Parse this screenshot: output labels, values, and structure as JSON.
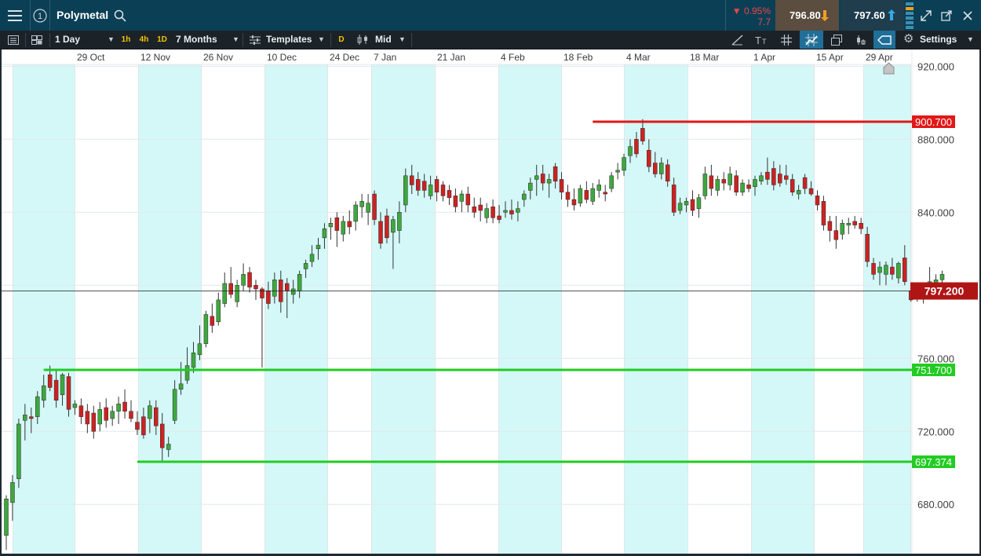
{
  "header": {
    "instrument": "Polymetal",
    "change_pct": "▼ 0.95%",
    "change_abs": "7.7",
    "sell_price": "796.80",
    "buy_price": "797.60"
  },
  "toolbar": {
    "interval": "1 Day",
    "quick_intervals": [
      "1h",
      "4h",
      "1D"
    ],
    "range": "7 Months",
    "templates_label": "Templates",
    "d_badge": "D",
    "price_type": "Mid",
    "settings_label": "Settings"
  },
  "colors": {
    "up": "#3ea83e",
    "down": "#cc2222",
    "resistance": "#e01818",
    "support": "#22cc22",
    "current_price": "#b01515",
    "band": "#d4f8f8"
  },
  "chart_data": {
    "type": "candlestick",
    "x_labels": [
      "29 Oct",
      "12 Nov",
      "26 Nov",
      "10 Dec",
      "24 Dec",
      "7 Jan",
      "21 Jan",
      "4 Feb",
      "18 Feb",
      "4 Mar",
      "18 Mar",
      "1 Apr",
      "15 Apr",
      "29 Apr"
    ],
    "y_ticks": [
      680,
      720,
      760,
      800,
      840,
      880,
      920
    ],
    "y_tick_labels": [
      "680.000",
      "720.000",
      "760.000",
      "800.000",
      "840.000",
      "880.000",
      "920.000"
    ],
    "ylim": [
      653,
      921
    ],
    "grid": true,
    "current_price": 797.2,
    "current_price_label": "797.200",
    "price_lines": [
      {
        "value": 889.7,
        "label": "900.700",
        "kind": "resistance"
      },
      {
        "value": 753.5,
        "label": "751.700",
        "kind": "support"
      },
      {
        "value": 703.2,
        "label": "697.374",
        "kind": "support"
      }
    ],
    "candles": [
      {
        "o": 663,
        "h": 685,
        "l": 655,
        "c": 683
      },
      {
        "o": 681,
        "h": 696,
        "l": 671,
        "c": 692
      },
      {
        "o": 694,
        "h": 727,
        "l": 689,
        "c": 724
      },
      {
        "o": 726,
        "h": 735,
        "l": 715,
        "c": 729
      },
      {
        "o": 728,
        "h": 733,
        "l": 719,
        "c": 727
      },
      {
        "o": 728,
        "h": 742,
        "l": 724,
        "c": 739
      },
      {
        "o": 737,
        "h": 751,
        "l": 733,
        "c": 745
      },
      {
        "o": 751,
        "h": 756,
        "l": 742,
        "c": 744
      },
      {
        "o": 748,
        "h": 754,
        "l": 733,
        "c": 737
      },
      {
        "o": 740,
        "h": 752,
        "l": 734,
        "c": 751
      },
      {
        "o": 750,
        "h": 752,
        "l": 728,
        "c": 732
      },
      {
        "o": 733,
        "h": 737,
        "l": 729,
        "c": 735
      },
      {
        "o": 734,
        "h": 738,
        "l": 724,
        "c": 728
      },
      {
        "o": 731,
        "h": 735,
        "l": 719,
        "c": 724
      },
      {
        "o": 730,
        "h": 734,
        "l": 716,
        "c": 720
      },
      {
        "o": 724,
        "h": 736,
        "l": 720,
        "c": 732
      },
      {
        "o": 733,
        "h": 738,
        "l": 722,
        "c": 726
      },
      {
        "o": 727,
        "h": 734,
        "l": 723,
        "c": 731
      },
      {
        "o": 731,
        "h": 739,
        "l": 724,
        "c": 735
      },
      {
        "o": 736,
        "h": 743,
        "l": 727,
        "c": 731
      },
      {
        "o": 731,
        "h": 737,
        "l": 725,
        "c": 727
      },
      {
        "o": 725,
        "h": 731,
        "l": 718,
        "c": 721
      },
      {
        "o": 728,
        "h": 733,
        "l": 716,
        "c": 718
      },
      {
        "o": 727,
        "h": 737,
        "l": 719,
        "c": 734
      },
      {
        "o": 733,
        "h": 737,
        "l": 718,
        "c": 723
      },
      {
        "o": 724,
        "h": 730,
        "l": 703,
        "c": 711
      },
      {
        "o": 710,
        "h": 717,
        "l": 706,
        "c": 713
      },
      {
        "o": 726,
        "h": 748,
        "l": 724,
        "c": 743
      },
      {
        "o": 743,
        "h": 758,
        "l": 740,
        "c": 746
      },
      {
        "o": 748,
        "h": 766,
        "l": 746,
        "c": 756
      },
      {
        "o": 755,
        "h": 769,
        "l": 752,
        "c": 763
      },
      {
        "o": 762,
        "h": 778,
        "l": 759,
        "c": 768
      },
      {
        "o": 768,
        "h": 786,
        "l": 766,
        "c": 784
      },
      {
        "o": 783,
        "h": 790,
        "l": 774,
        "c": 778
      },
      {
        "o": 780,
        "h": 796,
        "l": 778,
        "c": 792
      },
      {
        "o": 790,
        "h": 807,
        "l": 788,
        "c": 801
      },
      {
        "o": 801,
        "h": 810,
        "l": 793,
        "c": 795
      },
      {
        "o": 791,
        "h": 803,
        "l": 788,
        "c": 800
      },
      {
        "o": 800,
        "h": 812,
        "l": 797,
        "c": 806
      },
      {
        "o": 807,
        "h": 810,
        "l": 796,
        "c": 799
      },
      {
        "o": 800,
        "h": 803,
        "l": 792,
        "c": 798
      },
      {
        "o": 798,
        "h": 799,
        "l": 755,
        "c": 793
      },
      {
        "o": 797,
        "h": 802,
        "l": 787,
        "c": 790
      },
      {
        "o": 794,
        "h": 807,
        "l": 790,
        "c": 803
      },
      {
        "o": 803,
        "h": 808,
        "l": 785,
        "c": 791
      },
      {
        "o": 801,
        "h": 804,
        "l": 782,
        "c": 797
      },
      {
        "o": 795,
        "h": 803,
        "l": 790,
        "c": 798
      },
      {
        "o": 797,
        "h": 808,
        "l": 793,
        "c": 806
      },
      {
        "o": 809,
        "h": 814,
        "l": 804,
        "c": 812
      },
      {
        "o": 813,
        "h": 822,
        "l": 810,
        "c": 817
      },
      {
        "o": 820,
        "h": 826,
        "l": 814,
        "c": 822
      },
      {
        "o": 826,
        "h": 834,
        "l": 820,
        "c": 831
      },
      {
        "o": 832,
        "h": 837,
        "l": 825,
        "c": 834
      },
      {
        "o": 837,
        "h": 840,
        "l": 821,
        "c": 830
      },
      {
        "o": 828,
        "h": 838,
        "l": 824,
        "c": 835
      },
      {
        "o": 835,
        "h": 841,
        "l": 828,
        "c": 832
      },
      {
        "o": 835,
        "h": 846,
        "l": 830,
        "c": 844
      },
      {
        "o": 843,
        "h": 850,
        "l": 837,
        "c": 846
      },
      {
        "o": 840,
        "h": 850,
        "l": 833,
        "c": 845
      },
      {
        "o": 850,
        "h": 852,
        "l": 833,
        "c": 836
      },
      {
        "o": 835,
        "h": 840,
        "l": 820,
        "c": 823
      },
      {
        "o": 838,
        "h": 842,
        "l": 823,
        "c": 826
      },
      {
        "o": 829,
        "h": 838,
        "l": 809,
        "c": 836
      },
      {
        "o": 830,
        "h": 846,
        "l": 823,
        "c": 840
      },
      {
        "o": 844,
        "h": 864,
        "l": 840,
        "c": 860
      },
      {
        "o": 860,
        "h": 866,
        "l": 850,
        "c": 855
      },
      {
        "o": 858,
        "h": 862,
        "l": 849,
        "c": 852
      },
      {
        "o": 857,
        "h": 861,
        "l": 848,
        "c": 852
      },
      {
        "o": 849,
        "h": 860,
        "l": 847,
        "c": 855
      },
      {
        "o": 858,
        "h": 860,
        "l": 846,
        "c": 851
      },
      {
        "o": 855,
        "h": 857,
        "l": 846,
        "c": 849
      },
      {
        "o": 852,
        "h": 855,
        "l": 844,
        "c": 848
      },
      {
        "o": 849,
        "h": 853,
        "l": 840,
        "c": 843
      },
      {
        "o": 846,
        "h": 852,
        "l": 840,
        "c": 850
      },
      {
        "o": 850,
        "h": 854,
        "l": 840,
        "c": 844
      },
      {
        "o": 843,
        "h": 848,
        "l": 837,
        "c": 840
      },
      {
        "o": 844,
        "h": 848,
        "l": 835,
        "c": 841
      },
      {
        "o": 837,
        "h": 845,
        "l": 834,
        "c": 842
      },
      {
        "o": 843,
        "h": 847,
        "l": 834,
        "c": 837
      },
      {
        "o": 838,
        "h": 844,
        "l": 834,
        "c": 836
      },
      {
        "o": 840,
        "h": 846,
        "l": 837,
        "c": 841
      },
      {
        "o": 841,
        "h": 847,
        "l": 836,
        "c": 839
      },
      {
        "o": 840,
        "h": 846,
        "l": 835,
        "c": 842
      },
      {
        "o": 847,
        "h": 852,
        "l": 843,
        "c": 850
      },
      {
        "o": 852,
        "h": 859,
        "l": 847,
        "c": 856
      },
      {
        "o": 858,
        "h": 866,
        "l": 849,
        "c": 860
      },
      {
        "o": 861,
        "h": 866,
        "l": 852,
        "c": 856
      },
      {
        "o": 856,
        "h": 861,
        "l": 848,
        "c": 858
      },
      {
        "o": 865,
        "h": 867,
        "l": 853,
        "c": 857
      },
      {
        "o": 858,
        "h": 862,
        "l": 847,
        "c": 851
      },
      {
        "o": 851,
        "h": 855,
        "l": 843,
        "c": 847
      },
      {
        "o": 847,
        "h": 853,
        "l": 841,
        "c": 844
      },
      {
        "o": 845,
        "h": 855,
        "l": 843,
        "c": 853
      },
      {
        "o": 852,
        "h": 857,
        "l": 845,
        "c": 847
      },
      {
        "o": 846,
        "h": 856,
        "l": 844,
        "c": 853
      },
      {
        "o": 852,
        "h": 858,
        "l": 848,
        "c": 855
      },
      {
        "o": 851,
        "h": 855,
        "l": 846,
        "c": 850
      },
      {
        "o": 853,
        "h": 862,
        "l": 851,
        "c": 860
      },
      {
        "o": 862,
        "h": 867,
        "l": 858,
        "c": 863
      },
      {
        "o": 863,
        "h": 872,
        "l": 860,
        "c": 870
      },
      {
        "o": 871,
        "h": 880,
        "l": 867,
        "c": 876
      },
      {
        "o": 880,
        "h": 884,
        "l": 870,
        "c": 872
      },
      {
        "o": 886,
        "h": 891,
        "l": 877,
        "c": 879
      },
      {
        "o": 874,
        "h": 880,
        "l": 862,
        "c": 865
      },
      {
        "o": 867,
        "h": 873,
        "l": 859,
        "c": 861
      },
      {
        "o": 861,
        "h": 870,
        "l": 858,
        "c": 867
      },
      {
        "o": 866,
        "h": 869,
        "l": 854,
        "c": 857
      },
      {
        "o": 855,
        "h": 859,
        "l": 838,
        "c": 840
      },
      {
        "o": 841,
        "h": 848,
        "l": 839,
        "c": 845
      },
      {
        "o": 844,
        "h": 848,
        "l": 840,
        "c": 846
      },
      {
        "o": 847,
        "h": 852,
        "l": 838,
        "c": 841
      },
      {
        "o": 842,
        "h": 850,
        "l": 837,
        "c": 848
      },
      {
        "o": 849,
        "h": 865,
        "l": 847,
        "c": 861
      },
      {
        "o": 860,
        "h": 866,
        "l": 849,
        "c": 853
      },
      {
        "o": 852,
        "h": 860,
        "l": 849,
        "c": 858
      },
      {
        "o": 858,
        "h": 862,
        "l": 852,
        "c": 856
      },
      {
        "o": 855,
        "h": 865,
        "l": 852,
        "c": 861
      },
      {
        "o": 860,
        "h": 863,
        "l": 849,
        "c": 851
      },
      {
        "o": 851,
        "h": 858,
        "l": 849,
        "c": 856
      },
      {
        "o": 855,
        "h": 858,
        "l": 851,
        "c": 853
      },
      {
        "o": 854,
        "h": 860,
        "l": 849,
        "c": 858
      },
      {
        "o": 857,
        "h": 862,
        "l": 855,
        "c": 860
      },
      {
        "o": 862,
        "h": 870,
        "l": 855,
        "c": 858
      },
      {
        "o": 864,
        "h": 868,
        "l": 852,
        "c": 855
      },
      {
        "o": 861,
        "h": 866,
        "l": 854,
        "c": 856
      },
      {
        "o": 860,
        "h": 866,
        "l": 855,
        "c": 858
      },
      {
        "o": 858,
        "h": 861,
        "l": 849,
        "c": 851
      },
      {
        "o": 850,
        "h": 855,
        "l": 847,
        "c": 852
      },
      {
        "o": 859,
        "h": 861,
        "l": 850,
        "c": 853
      },
      {
        "o": 853,
        "h": 857,
        "l": 849,
        "c": 850
      },
      {
        "o": 849,
        "h": 852,
        "l": 841,
        "c": 844
      },
      {
        "o": 846,
        "h": 849,
        "l": 830,
        "c": 833
      },
      {
        "o": 835,
        "h": 838,
        "l": 824,
        "c": 830
      },
      {
        "o": 830,
        "h": 838,
        "l": 820,
        "c": 825
      },
      {
        "o": 828,
        "h": 836,
        "l": 825,
        "c": 834
      },
      {
        "o": 833,
        "h": 837,
        "l": 828,
        "c": 834
      },
      {
        "o": 835,
        "h": 838,
        "l": 831,
        "c": 833
      },
      {
        "o": 834,
        "h": 837,
        "l": 828,
        "c": 831
      },
      {
        "o": 828,
        "h": 832,
        "l": 810,
        "c": 813
      },
      {
        "o": 812,
        "h": 815,
        "l": 803,
        "c": 806
      },
      {
        "o": 807,
        "h": 813,
        "l": 800,
        "c": 810
      },
      {
        "o": 806,
        "h": 813,
        "l": 800,
        "c": 811
      },
      {
        "o": 810,
        "h": 815,
        "l": 803,
        "c": 806
      },
      {
        "o": 804,
        "h": 813,
        "l": 801,
        "c": 812
      },
      {
        "o": 815,
        "h": 822,
        "l": 800,
        "c": 802
      },
      {
        "o": 797,
        "h": 800,
        "l": 791,
        "c": 792
      },
      {
        "o": 793,
        "h": 797,
        "l": 791,
        "c": 796
      },
      {
        "o": 795,
        "h": 801,
        "l": 790,
        "c": 799
      },
      {
        "o": 799,
        "h": 810,
        "l": 797,
        "c": 802
      },
      {
        "o": 801,
        "h": 806,
        "l": 798,
        "c": 803
      },
      {
        "o": 803,
        "h": 808,
        "l": 801,
        "c": 806
      },
      {
        "o": 797,
        "h": 798,
        "l": 796,
        "c": 797
      }
    ]
  }
}
